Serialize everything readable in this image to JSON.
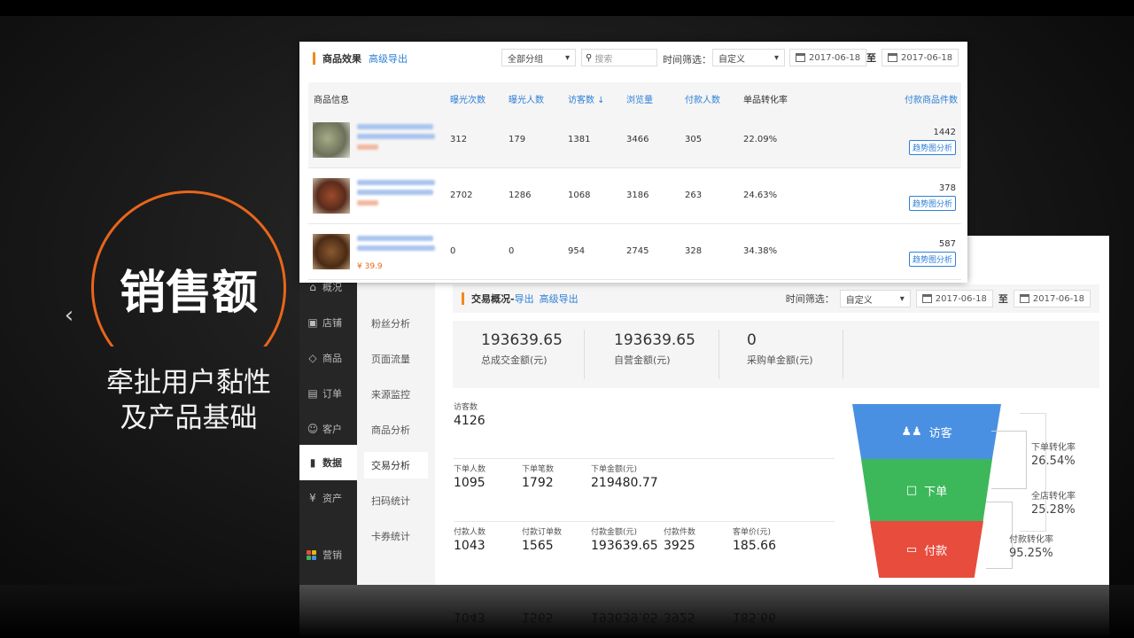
{
  "slide": {
    "title": "销售额",
    "subtitle_line1": "牵扯用户黏性",
    "subtitle_line2": "及产品基础",
    "prev_icon": "chevron-left-icon",
    "accent_color": "#e8661b"
  },
  "product_panel": {
    "title": "商品效果",
    "export_link": "高级导出",
    "group_select": "全部分组",
    "search_placeholder": "搜索",
    "time_filter_label": "时间筛选：",
    "time_filter_value": "自定义",
    "date_from": "2017-06-18",
    "to_label": "至",
    "date_to": "2017-06-18",
    "columns": [
      "商品信息",
      "曝光次数",
      "曝光人数",
      "访客数 ↓",
      "浏览量",
      "付款人数",
      "单品转化率",
      "付款商品件数"
    ],
    "rows": [
      {
        "cells": [
          "312",
          "179",
          "1381",
          "3466",
          "305",
          "22.09%"
        ],
        "count": "1442",
        "price": "",
        "trend_label": "趋势图分析"
      },
      {
        "cells": [
          "2702",
          "1286",
          "1068",
          "3186",
          "263",
          "24.63%"
        ],
        "count": "378",
        "price": "",
        "trend_label": "趋势图分析"
      },
      {
        "cells": [
          "0",
          "0",
          "954",
          "2745",
          "328",
          "34.38%"
        ],
        "count": "587",
        "price": "¥ 39.9",
        "trend_label": "趋势图分析"
      }
    ]
  },
  "trade_panel": {
    "sidebar": [
      {
        "label": "概况",
        "icon": "home-icon"
      },
      {
        "label": "店铺",
        "icon": "store-icon"
      },
      {
        "label": "商品",
        "icon": "tag-icon"
      },
      {
        "label": "订单",
        "icon": "list-icon"
      },
      {
        "label": "客户",
        "icon": "user-icon"
      },
      {
        "label": "数据",
        "icon": "bar-chart-icon"
      },
      {
        "label": "资产",
        "icon": "yen-icon"
      },
      {
        "label": "营销",
        "icon": "grid-icon"
      }
    ],
    "submenu": [
      "粉丝分析",
      "页面流量",
      "来源监控",
      "商品分析",
      "交易分析",
      "扫码统计",
      "卡券统计"
    ],
    "header_title": "交易概况-",
    "export_link": "导出",
    "advanced_export_link": "高级导出",
    "time_filter_label": "时间筛选：",
    "time_filter_value": "自定义",
    "date_from": "2017-06-18",
    "to_label": "至",
    "date_to": "2017-06-18",
    "summary": [
      {
        "value": "193639.65",
        "label": "总成交金额(元)"
      },
      {
        "value": "193639.65",
        "label": "自营金额(元)"
      },
      {
        "value": "0",
        "label": "采购单金额(元)"
      }
    ],
    "visitors": {
      "label": "访客数",
      "value": "4126"
    },
    "orders": [
      {
        "label": "下单人数",
        "value": "1095"
      },
      {
        "label": "下单笔数",
        "value": "1792"
      },
      {
        "label": "下单金额(元)",
        "value": "219480.77"
      }
    ],
    "payments": [
      {
        "label": "付款人数",
        "value": "1043"
      },
      {
        "label": "付款订单数",
        "value": "1565"
      },
      {
        "label": "付款金额(元)",
        "value": "193639.65"
      },
      {
        "label": "付款件数",
        "value": "3925"
      },
      {
        "label": "客单价(元)",
        "value": "185.66"
      }
    ],
    "funnel": [
      {
        "label": "访客",
        "color": "#4a90e2",
        "icon": "users-icon"
      },
      {
        "label": "下单",
        "color": "#3cb85a",
        "icon": "document-icon"
      },
      {
        "label": "付款",
        "color": "#e84c3d",
        "icon": "card-icon"
      }
    ],
    "rates": [
      {
        "label": "下单转化率",
        "value": "26.54%"
      },
      {
        "label": "全店转化率",
        "value": "25.28%"
      },
      {
        "label": "付款转化率",
        "value": "95.25%"
      }
    ]
  }
}
